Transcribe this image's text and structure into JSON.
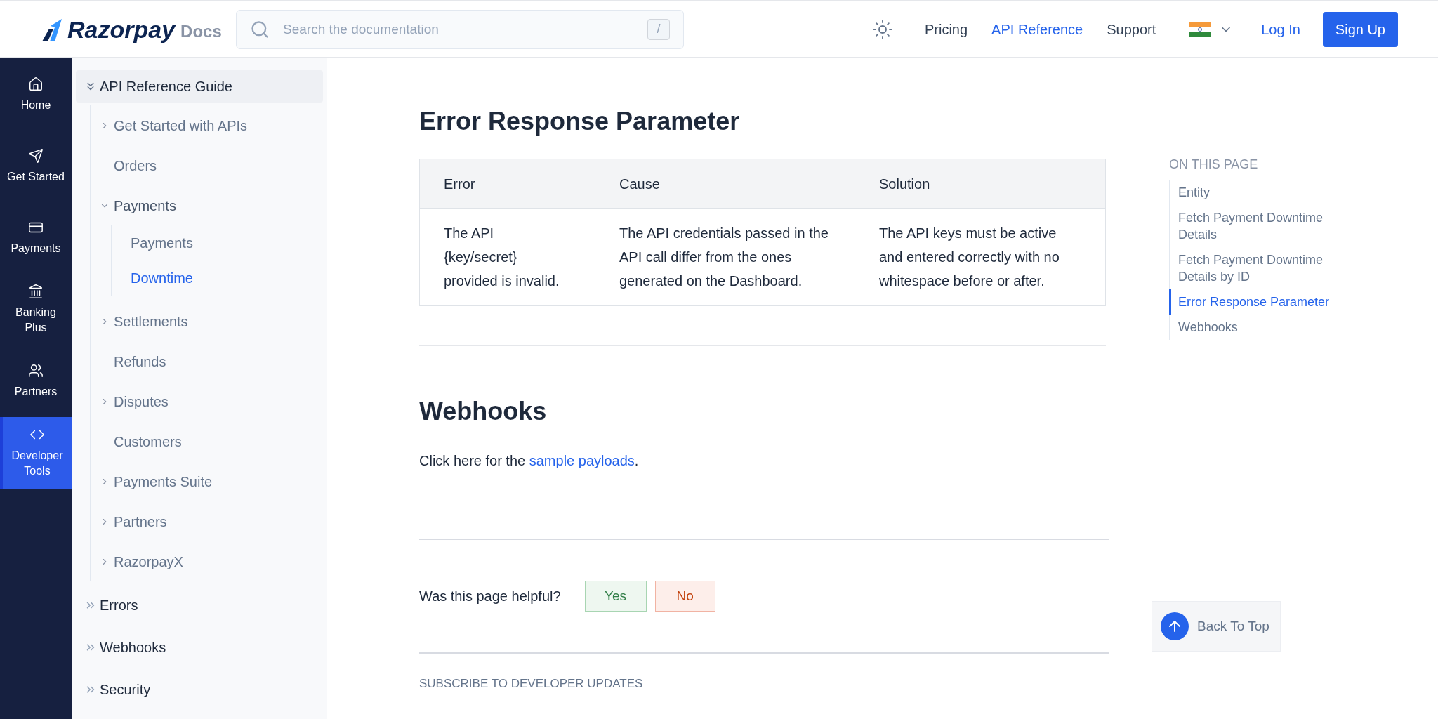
{
  "header": {
    "logo": "Razorpay",
    "logo_suffix": "Docs",
    "search": {
      "placeholder": "Search the documentation",
      "shortcut": "/"
    },
    "nav": [
      {
        "label": "Pricing",
        "selected": false
      },
      {
        "label": "API Reference",
        "selected": true
      },
      {
        "label": "Support",
        "selected": false
      }
    ],
    "login": "Log In",
    "signup": "Sign Up"
  },
  "rail": [
    {
      "label": "Home",
      "selected": false
    },
    {
      "label": "Get Started",
      "selected": false
    },
    {
      "label": "Payments",
      "selected": false
    },
    {
      "label": "Banking Plus",
      "selected": false
    },
    {
      "label": "Partners",
      "selected": false
    },
    {
      "label": "Developer Tools",
      "selected": true
    }
  ],
  "sidebar": [
    {
      "label": "API Reference Guide",
      "expanded": true,
      "children": [
        {
          "label": "Get Started with APIs",
          "kind": "group",
          "expanded": false,
          "selected": false
        },
        {
          "label": "Orders",
          "kind": "link",
          "selected": false
        },
        {
          "label": "Payments",
          "kind": "group",
          "expanded": true,
          "selected": false,
          "children": [
            {
              "label": "Payments",
              "selected": false
            },
            {
              "label": "Downtime",
              "selected": true
            }
          ]
        },
        {
          "label": "Settlements",
          "kind": "group",
          "expanded": false,
          "selected": false
        },
        {
          "label": "Refunds",
          "kind": "link",
          "selected": false
        },
        {
          "label": "Disputes",
          "kind": "group",
          "expanded": false,
          "selected": false
        },
        {
          "label": "Customers",
          "kind": "link",
          "selected": false
        },
        {
          "label": "Payments Suite",
          "kind": "group",
          "expanded": false,
          "selected": false
        },
        {
          "label": "Partners",
          "kind": "group",
          "expanded": false,
          "selected": false
        },
        {
          "label": "RazorpayX",
          "kind": "group",
          "expanded": false,
          "selected": false
        }
      ]
    },
    {
      "label": "Errors",
      "expanded": false
    },
    {
      "label": "Webhooks",
      "expanded": false
    },
    {
      "label": "Security",
      "expanded": false
    }
  ],
  "content": {
    "heading": "Error Response Parameter",
    "table": {
      "columns": [
        "Error",
        "Cause",
        "Solution"
      ],
      "rows": [
        [
          "The API {key/secret} provided is invalid.",
          "The API credentials passed in the API call differ from the ones generated on the Dashboard.",
          "The API keys must be active and entered correctly with no whitespace before or after."
        ]
      ]
    },
    "section_heading": "Webhooks",
    "paragraph": {
      "before": "Click here for the ",
      "link": "sample payloads",
      "after": "."
    },
    "feedback": {
      "question": "Was this page helpful?",
      "yes": "Yes",
      "no": "No"
    },
    "subscribe": "SUBSCRIBE TO DEVELOPER UPDATES"
  },
  "toc": {
    "title": "ON THIS PAGE",
    "items": [
      {
        "label": "Entity",
        "selected": false
      },
      {
        "label": "Fetch Payment Downtime Details",
        "selected": false
      },
      {
        "label": "Fetch Payment Downtime Details by ID",
        "selected": false
      },
      {
        "label": "Error Response Parameter",
        "selected": true
      },
      {
        "label": "Webhooks",
        "selected": false
      }
    ]
  },
  "back_to_top": "Back To Top"
}
